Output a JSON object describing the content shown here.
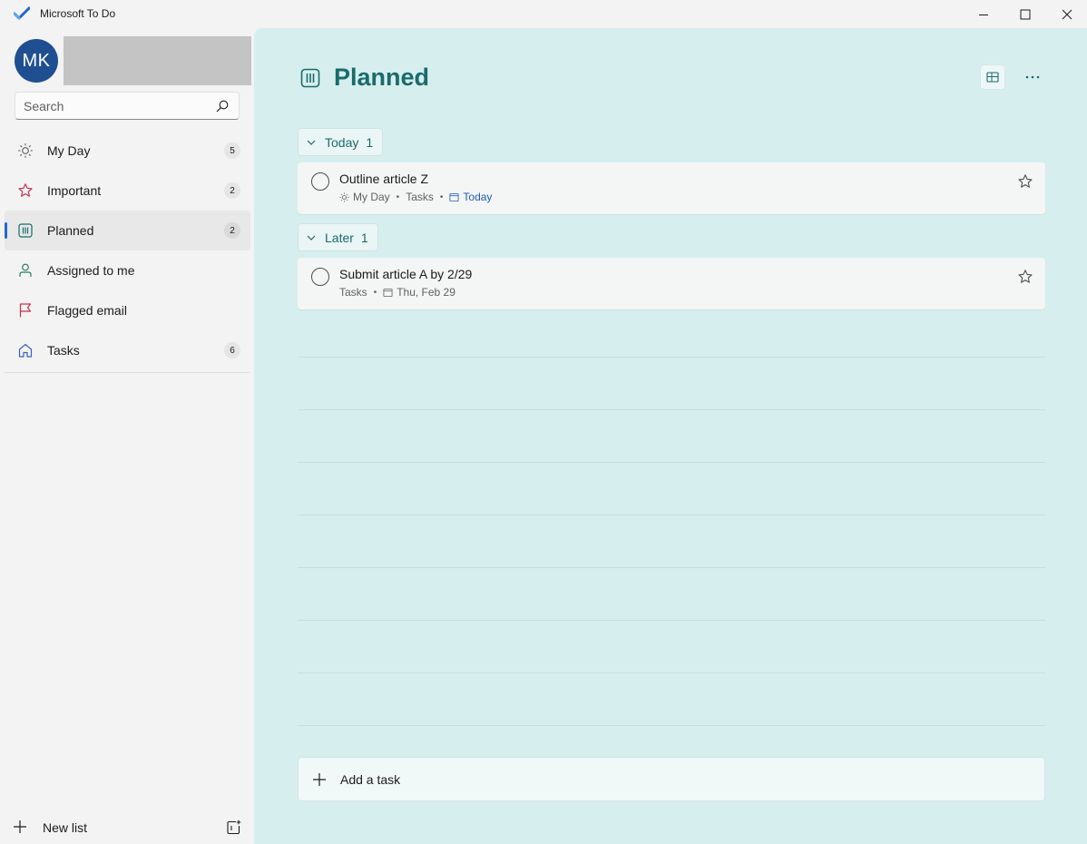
{
  "window": {
    "title": "Microsoft To Do",
    "icons": [
      "app-check-icon",
      "minimize-icon",
      "maximize-icon",
      "close-icon"
    ]
  },
  "account": {
    "initials": "MK",
    "avatar_color": "#1f4f91"
  },
  "search": {
    "placeholder": "Search",
    "value": ""
  },
  "sidebar": {
    "items": [
      {
        "label": "My Day",
        "count": "5",
        "icon": "sun-icon"
      },
      {
        "label": "Important",
        "count": "2",
        "icon": "star-icon"
      },
      {
        "label": "Planned",
        "count": "2",
        "icon": "planner-icon",
        "selected": true
      },
      {
        "label": "Assigned to me",
        "count": "",
        "icon": "person-icon"
      },
      {
        "label": "Flagged email",
        "count": "",
        "icon": "flag-icon"
      },
      {
        "label": "Tasks",
        "count": "6",
        "icon": "home-icon"
      }
    ],
    "new_list_label": "New list"
  },
  "main": {
    "title": "Planned",
    "accent_color": "#1a6b6a",
    "background_color": "#d6efee",
    "groups": [
      {
        "label": "Today",
        "count": "1",
        "tasks": [
          {
            "title": "Outline article Z",
            "meta_myday": "My Day",
            "meta_list": "Tasks",
            "meta_due": "Today"
          }
        ]
      },
      {
        "label": "Later",
        "count": "1",
        "tasks": [
          {
            "title": "Submit article A by 2/29",
            "meta_list": "Tasks",
            "meta_due": "Thu, Feb 29"
          }
        ]
      }
    ],
    "add_task_placeholder": "Add a task"
  }
}
